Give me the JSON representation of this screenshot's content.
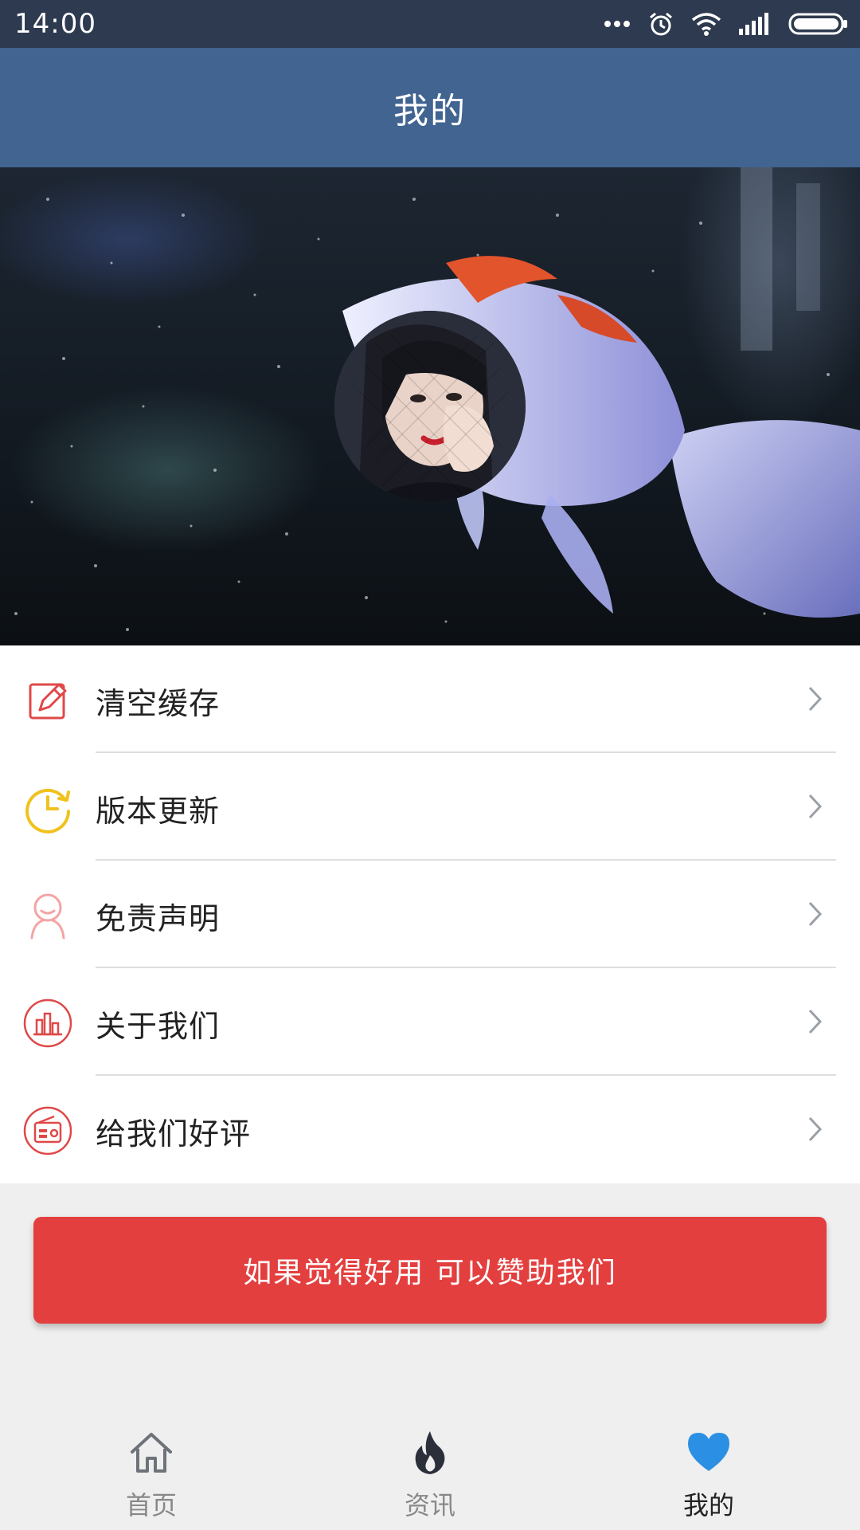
{
  "status_bar": {
    "time": "14:00"
  },
  "header": {
    "title": "我的"
  },
  "menu": {
    "items": [
      {
        "label": "清空缓存",
        "icon": "edit-icon"
      },
      {
        "label": "版本更新",
        "icon": "clock-icon"
      },
      {
        "label": "免责声明",
        "icon": "person-icon"
      },
      {
        "label": "关于我们",
        "icon": "bar-chart-icon"
      },
      {
        "label": "给我们好评",
        "icon": "radio-icon"
      }
    ]
  },
  "donate_button": {
    "label": "如果觉得好用 可以赞助我们"
  },
  "bottom_nav": {
    "items": [
      {
        "label": "首页",
        "icon": "home-icon",
        "active": false
      },
      {
        "label": "资讯",
        "icon": "flame-icon",
        "active": false
      },
      {
        "label": "我的",
        "icon": "heart-icon",
        "active": true
      }
    ]
  },
  "colors": {
    "status_bar": "#2e3a4f",
    "title_bar": "#416491",
    "accent_red": "#e33f3f",
    "accent_blue": "#2b8fe3"
  }
}
